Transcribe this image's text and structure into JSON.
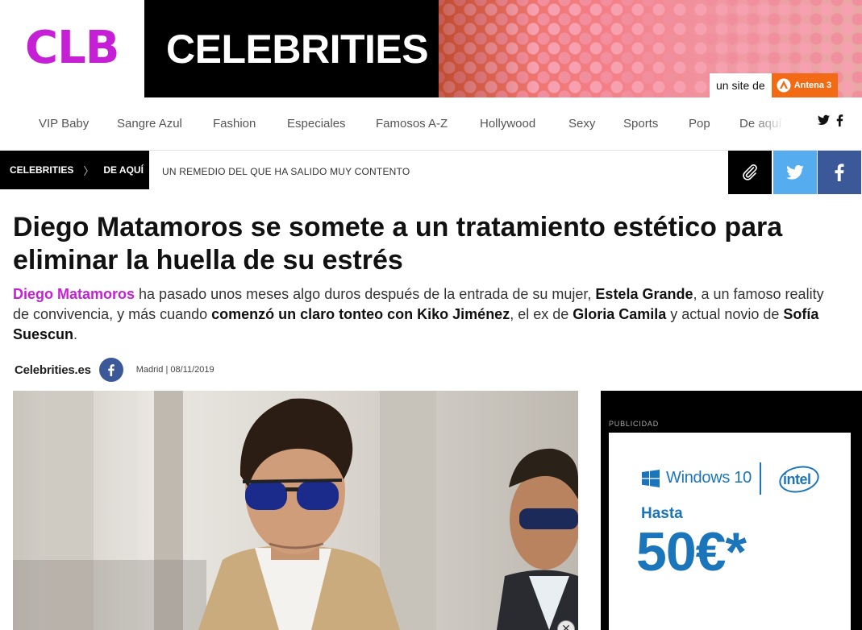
{
  "header": {
    "logo": "CLB",
    "brand": "CELEBRITIES",
    "site_tag": "un site de",
    "network": "Antena 3"
  },
  "nav": {
    "items": [
      "VIP Baby",
      "Sangre Azul",
      "Fashion",
      "Especiales",
      "Famosos A-Z",
      "Hollywood",
      "Sexy",
      "Sports",
      "Pop",
      "De aquí"
    ],
    "social_icons": [
      "twitter-icon",
      "facebook-icon"
    ]
  },
  "breadcrumb": {
    "items": [
      "CELEBRITIES",
      "DE AQUÍ"
    ],
    "separator": "〉",
    "headline": "UN REMEDIO DEL QUE HA SALIDO MUY CONTENTO"
  },
  "share": {
    "buttons": [
      "link-icon",
      "twitter-icon",
      "facebook-icon"
    ],
    "colors": {
      "link": "#000000",
      "twitter": "#55acee",
      "facebook": "#3b5998"
    }
  },
  "article": {
    "title": "Diego Matamoros se somete a un tratamiento estético para eliminar la huella de su estrés",
    "lede": {
      "p1": "Diego Matamoros",
      "p2": " ha pasado unos meses algo duros después de la entrada de su mujer, ",
      "p3": "Estela Grande",
      "p4": ", a un famoso reality de convivencia, y más cuando ",
      "p5": "comenzó un claro tonteo con Kiko Jiménez",
      "p6": ", el ex de ",
      "p7": "Gloria Camila",
      "p8": " y actual novio de ",
      "p9": "Sofía Suescun",
      "p10": "."
    },
    "byline": {
      "author": "Celebrities.es",
      "meta": "Madrid | 08/11/2019"
    },
    "photo_close": "✕"
  },
  "ad": {
    "label": "PUBLICIDAD",
    "windows": "Windows 10",
    "intel": "intel",
    "hasta": "Hasta",
    "price": "50€*"
  },
  "colors": {
    "accent": "#c620d6",
    "ad_blue": "#1b75bb",
    "antena_orange": "#f26a14"
  }
}
